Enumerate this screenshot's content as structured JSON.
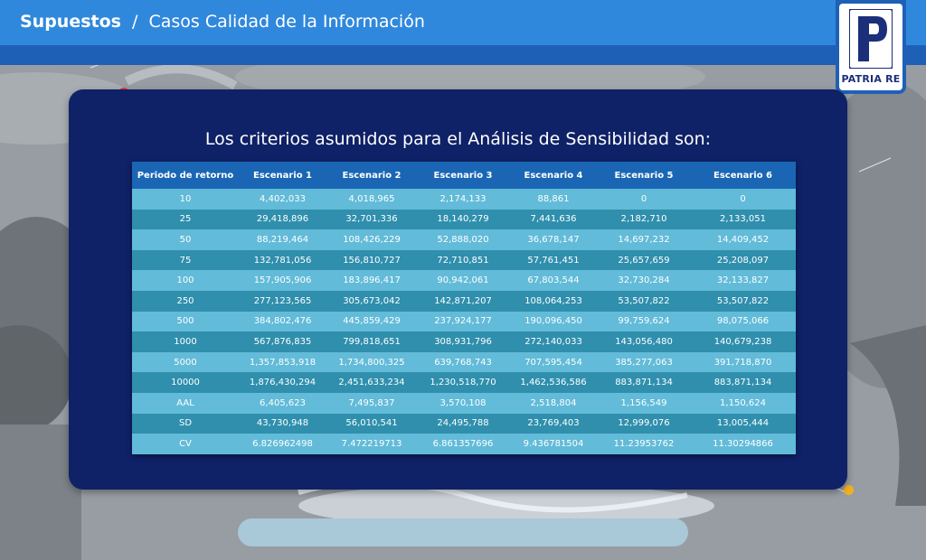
{
  "header": {
    "section": "Supuestos",
    "separator": "/",
    "subtitle": "Casos Calidad de la Información"
  },
  "logo": {
    "text": "PATRIA RE",
    "icon": "patria-re-logo-icon"
  },
  "panel": {
    "title": "Los criterios asumidos para el Análisis de Sensibilidad son:"
  },
  "colors": {
    "header_bar": "#2f88dc",
    "panel": "#0f2167",
    "table_header": "#1a66b5",
    "row_light": "#62bbd8",
    "row_dark": "#2f8fad"
  },
  "table": {
    "headers": [
      "Periodo de retorno",
      "Escenario 1",
      "Escenario 2",
      "Escenario 3",
      "Escenario 4",
      "Escenario 5",
      "Escenario 6"
    ],
    "rows": [
      [
        "10",
        "4,402,033",
        "4,018,965",
        "2,174,133",
        "88,861",
        "0",
        "0"
      ],
      [
        "25",
        "29,418,896",
        "32,701,336",
        "18,140,279",
        "7,441,636",
        "2,182,710",
        "2,133,051"
      ],
      [
        "50",
        "88,219,464",
        "108,426,229",
        "52,888,020",
        "36,678,147",
        "14,697,232",
        "14,409,452"
      ],
      [
        "75",
        "132,781,056",
        "156,810,727",
        "72,710,851",
        "57,761,451",
        "25,657,659",
        "25,208,097"
      ],
      [
        "100",
        "157,905,906",
        "183,896,417",
        "90,942,061",
        "67,803,544",
        "32,730,284",
        "32,133,827"
      ],
      [
        "250",
        "277,123,565",
        "305,673,042",
        "142,871,207",
        "108,064,253",
        "53,507,822",
        "53,507,822"
      ],
      [
        "500",
        "384,802,476",
        "445,859,429",
        "237,924,177",
        "190,096,450",
        "99,759,624",
        "98,075,066"
      ],
      [
        "1000",
        "567,876,835",
        "799,818,651",
        "308,931,796",
        "272,140,033",
        "143,056,480",
        "140,679,238"
      ],
      [
        "5000",
        "1,357,853,918",
        "1,734,800,325",
        "639,768,743",
        "707,595,454",
        "385,277,063",
        "391,718,870"
      ],
      [
        "10000",
        "1,876,430,294",
        "2,451,633,234",
        "1,230,518,770",
        "1,462,536,586",
        "883,871,134",
        "883,871,134"
      ],
      [
        "AAL",
        "6,405,623",
        "7,495,837",
        "3,570,108",
        "2,518,804",
        "1,156,549",
        "1,150,624"
      ],
      [
        "SD",
        "43,730,948",
        "56,010,541",
        "24,495,788",
        "23,769,403",
        "12,999,076",
        "13,005,444"
      ],
      [
        "CV",
        "6.826962498",
        "7.472219713",
        "6.861357696",
        "9.436781504",
        "11.23953762",
        "11.30294866"
      ]
    ]
  }
}
